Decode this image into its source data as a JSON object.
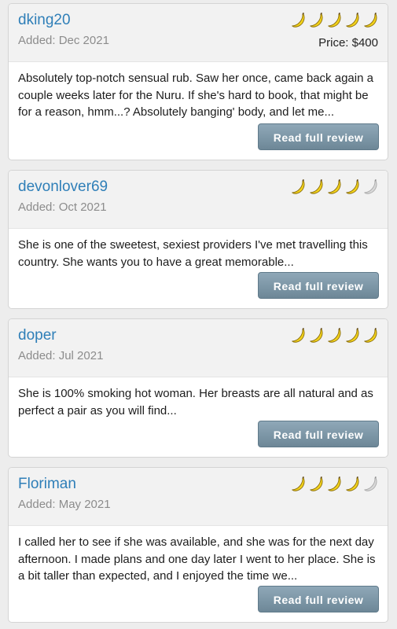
{
  "colors": {
    "link": "#2f7fb8",
    "banana_filled": "#f2d21b",
    "banana_empty": "#d9d9d9",
    "button": "#7b95a5"
  },
  "icons": {
    "rating": "banana-icon"
  },
  "reviews": [
    {
      "reviewer": "dking20",
      "added": "Added: Dec 2021",
      "price": "Price: $400",
      "rating": 5,
      "text": "Absolutely top-notch sensual rub. Saw her once, came back again a couple weeks later for the Nuru. If she's hard to book, that might be for a reason, hmm...? Absolutely banging' body, and let me...",
      "button_label": "Read full review"
    },
    {
      "reviewer": "devonlover69",
      "added": "Added: Oct 2021",
      "price": "",
      "rating": 4,
      "text": "She is one of the sweetest, sexiest providers I've met travelling this country. She wants you to have a great memorable...",
      "button_label": "Read full review"
    },
    {
      "reviewer": "doper",
      "added": "Added: Jul 2021",
      "price": "",
      "rating": 5,
      "text": "She is 100% smoking hot woman. Her breasts are all natural and as perfect a pair as you will find...",
      "button_label": "Read full review"
    },
    {
      "reviewer": "Floriman",
      "added": "Added: May 2021",
      "price": "",
      "rating": 4,
      "text": "I called her to see if she was available, and she was for the next day afternoon. I made plans and one day later I went to her place. She is a bit taller than expected, and I enjoyed the time we...",
      "button_label": "Read full review"
    }
  ]
}
